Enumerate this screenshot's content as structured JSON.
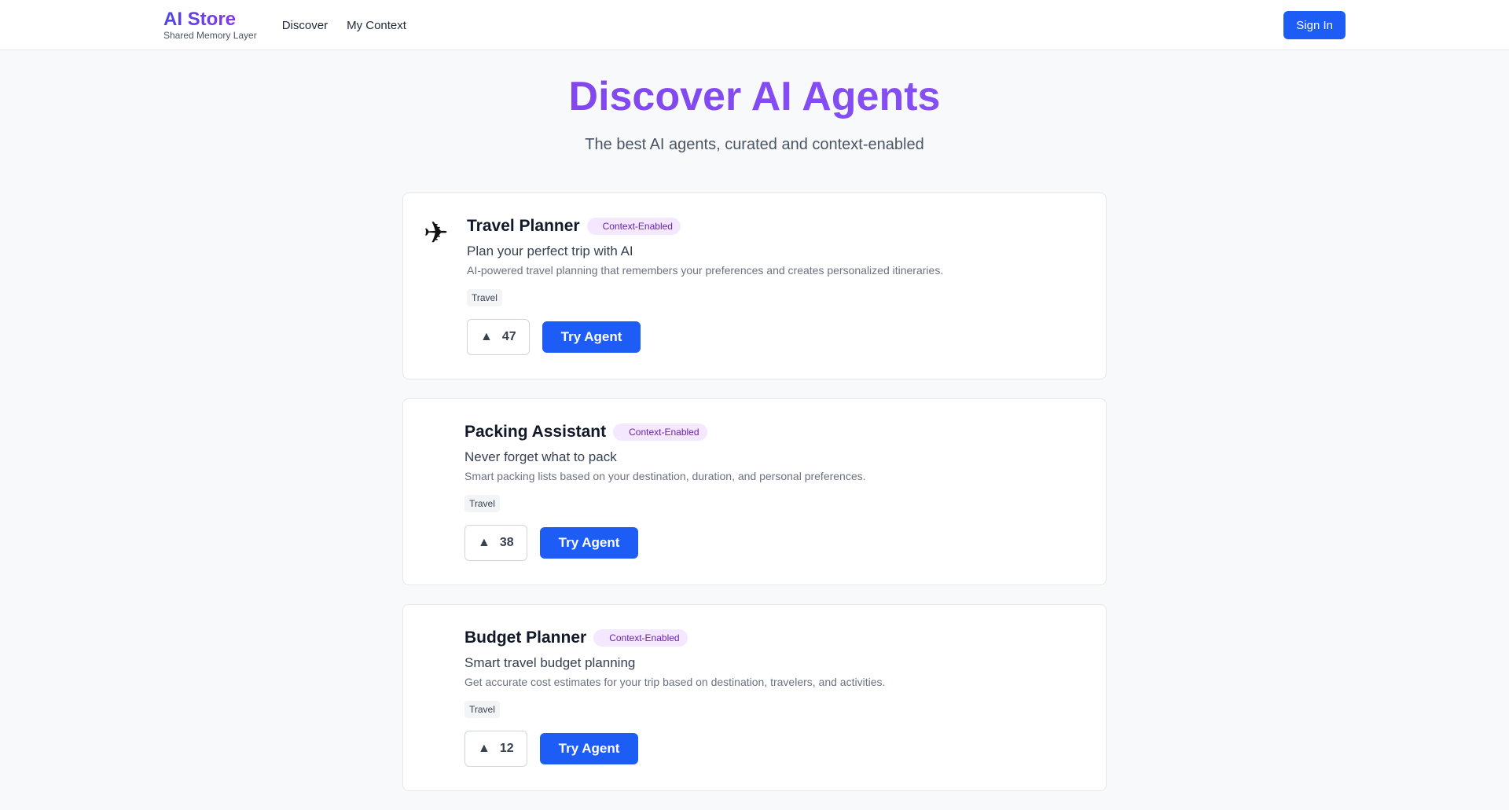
{
  "header": {
    "brand_title": "AI Store",
    "brand_subtitle": "Shared Memory Layer",
    "nav": [
      "Discover",
      "My Context"
    ],
    "signin_label": "Sign In"
  },
  "hero": {
    "title": "Discover AI Agents",
    "subtitle": "The best AI agents, curated and context-enabled"
  },
  "agents": [
    {
      "icon": "airplane-icon",
      "title": "Travel Planner",
      "badge": "Context-Enabled",
      "tagline": "Plan your perfect trip with AI",
      "description": "AI-powered travel planning that remembers your preferences and creates personalized itineraries.",
      "tag": "Travel",
      "upvotes": "47",
      "cta": "Try Agent"
    },
    {
      "title": "Packing Assistant",
      "badge": "Context-Enabled",
      "tagline": "Never forget what to pack",
      "description": "Smart packing lists based on your destination, duration, and personal preferences.",
      "tag": "Travel",
      "upvotes": "38",
      "cta": "Try Agent"
    },
    {
      "title": "Budget Planner",
      "badge": "Context-Enabled",
      "tagline": "Smart travel budget planning",
      "description": "Get accurate cost estimates for your trip based on destination, travelers, and activities.",
      "tag": "Travel",
      "upvotes": "12",
      "cta": "Try Agent"
    }
  ]
}
